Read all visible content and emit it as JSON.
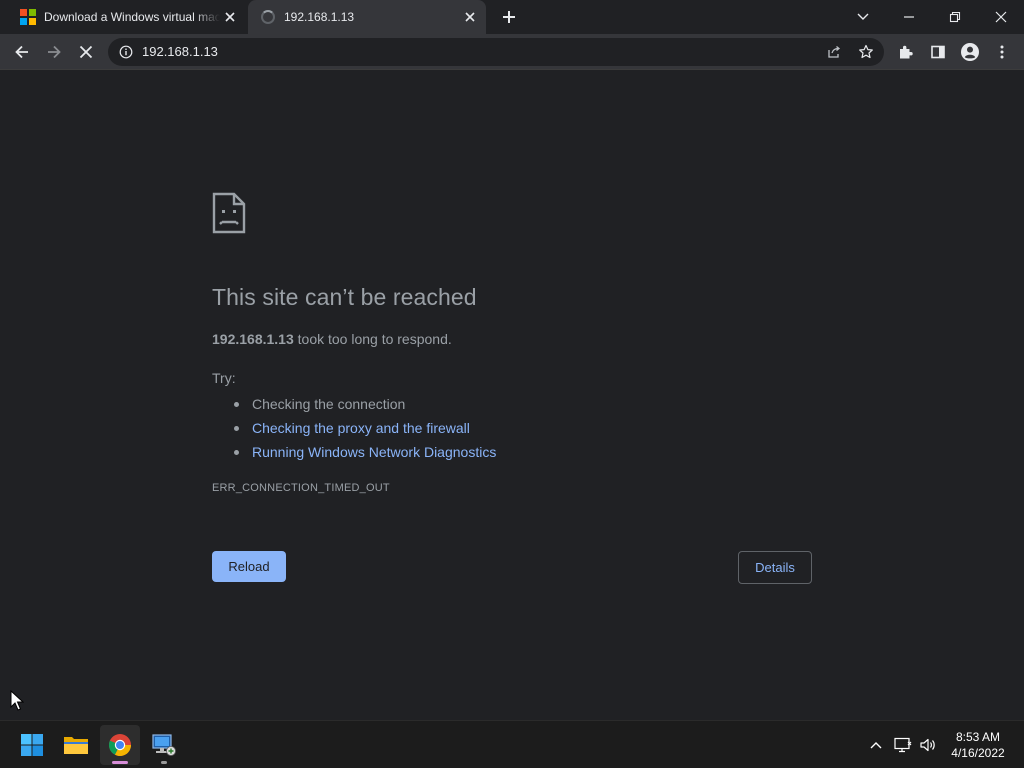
{
  "browser": {
    "tabs": [
      {
        "title": "Download a Windows virtual machine - Windows app development",
        "favicon": "microsoft-logo",
        "state": "inactive"
      },
      {
        "title": "192.168.1.13",
        "favicon": "loading-spinner",
        "state": "active"
      }
    ],
    "toolbar": {
      "url": "192.168.1.13",
      "icons": [
        "back-icon",
        "forward-icon",
        "stop-icon",
        "info-icon",
        "share-icon",
        "star-icon",
        "extensions-icon",
        "side-panel-icon",
        "profile-icon",
        "menu-icon"
      ]
    },
    "window_controls": [
      "tab-search-icon",
      "minimize-icon",
      "restore-icon",
      "close-icon"
    ]
  },
  "error_page": {
    "title": "This site can’t be reached",
    "host": "192.168.1.13",
    "summary_rest": " took too long to respond.",
    "try_label": "Try:",
    "suggestions": [
      {
        "text": "Checking the connection",
        "link": false
      },
      {
        "text": "Checking the proxy and the firewall",
        "link": true
      },
      {
        "text": "Running Windows Network Diagnostics",
        "link": true
      }
    ],
    "error_code": "ERR_CONNECTION_TIMED_OUT",
    "reload_label": "Reload",
    "details_label": "Details"
  },
  "taskbar": {
    "apps": [
      "start-icon",
      "file-explorer-icon",
      "chrome-icon",
      "remote-desktop-icon"
    ],
    "tray": [
      "chevron-up-icon",
      "network-icon",
      "volume-icon"
    ],
    "time": "8:53 AM",
    "date": "4/16/2022"
  },
  "colors": {
    "page_bg": "#202124",
    "toolbar_bg": "#35363a",
    "link": "#8ab4f8",
    "muted_text": "#9aa0a6",
    "taskbar_bg": "#1c1c1c"
  }
}
